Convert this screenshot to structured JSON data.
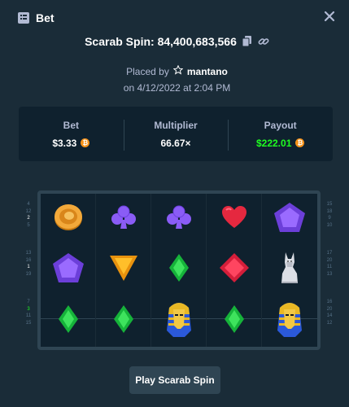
{
  "modal": {
    "title": "Bet",
    "title_icon": "bet-list-icon",
    "close_icon": "close-icon"
  },
  "game": {
    "label": "Scarab Spin: 84,400,683,566",
    "copy_icon": "copy-icon",
    "link_icon": "link-icon"
  },
  "placed": {
    "prefix": "Placed by",
    "user_icon": "star-outline-icon",
    "username": "mantano",
    "date": "on 4/12/2022 at 2:04 PM"
  },
  "stats": {
    "bet": {
      "label": "Bet",
      "value": "$3.33",
      "currency_icon": "bitcoin-icon"
    },
    "multiplier": {
      "label": "Multiplier",
      "value": "66.67×"
    },
    "payout": {
      "label": "Payout",
      "value": "$222.01",
      "currency_icon": "bitcoin-icon"
    }
  },
  "paylines_left": [
    [
      "4",
      "12",
      "2",
      "5"
    ],
    [
      "13",
      "16",
      "1",
      "19"
    ],
    [
      "7",
      "3",
      "11",
      "15"
    ]
  ],
  "paylines_right": [
    [
      "15",
      "18",
      "9",
      "10"
    ],
    [
      "17",
      "20",
      "11",
      "13"
    ],
    [
      "16",
      "20",
      "14",
      "12"
    ]
  ],
  "board": [
    [
      "gold-coin-icon",
      "purple-club-icon",
      "purple-club-icon",
      "red-heart-icon",
      "purple-pentagon-gem-icon"
    ],
    [
      "purple-pentagon-gem-icon",
      "orange-triangle-gem-icon",
      "green-diamond-icon",
      "red-diamond-gem-icon",
      "cat-statue-icon"
    ],
    [
      "green-diamond-icon",
      "green-diamond-icon",
      "pharaoh-mask-icon",
      "green-diamond-icon",
      "pharaoh-mask-icon"
    ]
  ],
  "play_button": "Play Scarab Spin",
  "colors": {
    "background": "#1a2c38",
    "panel": "#0f212e",
    "accent_green": "#1fff20",
    "coin": "#f7931a"
  }
}
